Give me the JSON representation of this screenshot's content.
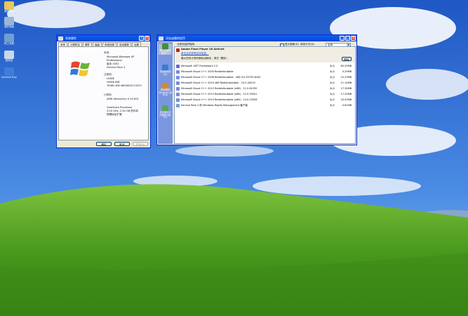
{
  "desktop": {
    "icons": [
      {
        "label": "我的文档",
        "icon": "folder-icon",
        "color": "#e8c85a"
      },
      {
        "label": "我的电脑",
        "icon": "computer-icon",
        "color": "#9ab6d6"
      },
      {
        "label": "网上邻居",
        "icon": "network-icon",
        "color": "#6f9fd0"
      },
      {
        "label": "回收站",
        "icon": "recycle-bin-icon",
        "color": "#c9d8e6"
      },
      {
        "label": "Internet Explorer",
        "icon": "ie-icon",
        "color": "#3d7dd8"
      }
    ]
  },
  "sysprops": {
    "title": "系统属性",
    "tabs": [
      "常规",
      "计算机名",
      "硬件",
      "高级",
      "系统还原",
      "自动更新",
      "远程"
    ],
    "system_header": "系统:",
    "os_lines": [
      "Microsoft Windows XP",
      "Professional",
      "版本 2002",
      "Service Pack 3"
    ],
    "registered_header": "注册到:",
    "registered_lines": [
      "HOME",
      "HOME-IDB",
      "76481-640-8834005-23370"
    ],
    "computer_header": "计算机:",
    "cpu_lines": [
      "AMD Athlon(tm) II X4 651",
      "",
      "QuadCore Processor",
      "3.00 GHz, 2.00 GB 的内存",
      "物理地址扩展"
    ],
    "ok": "确定",
    "cancel": "取消",
    "apply": "应用(A)"
  },
  "arp": {
    "title": "添加或删除程序",
    "sidebar": [
      {
        "label": "更改或删除程序(H)",
        "icon": "change-remove-icon",
        "color": "#3f8f3a"
      },
      {
        "label": "添加新程序(N)",
        "icon": "add-program-icon",
        "color": "#3a7ad6"
      },
      {
        "label": "添加/删除 Windows 组件(A)",
        "icon": "windows-components-icon",
        "color": "#d68a2e"
      },
      {
        "label": "设定程序访问和默认值(O)",
        "icon": "defaults-icon",
        "color": "#5aa35a"
      }
    ],
    "header": "当前安装的程序:",
    "show_updates": "显示更新(D)",
    "sort_label": "排序方式(S):",
    "sort_value": "名称",
    "selected": {
      "name": "Adobe Flash Player 26 ActiveX",
      "support_link": "单击此处获得支持信息。",
      "remove_text": "要从您的计算机删除该程序，单击 \"删除\"。",
      "remove_button": "删除"
    },
    "size_label": "大小",
    "programs": [
      {
        "name": "Microsoft .NET Framework 2.0",
        "size": "60.25MB",
        "color": "#6a6ad0"
      },
      {
        "name": "Microsoft Visual C++ 2005 Redistributable",
        "size": "0.29MB",
        "color": "#7a8ad6"
      },
      {
        "name": "Microsoft Visual C++ 2008 Redistributable - x86 9.0.30729.6161",
        "size": "10.23MB",
        "color": "#7a8ad6"
      },
      {
        "name": "Microsoft Visual C++ 2010  x86 Redistributable - 10.0.40219",
        "size": "11.14MB",
        "color": "#7a8ad6"
      },
      {
        "name": "Microsoft Visual C++ 2012 Redistributable (x86) - 11.0.61030",
        "size": "17.34MB",
        "color": "#7a8ad6"
      },
      {
        "name": "Microsoft Visual C++ 2013 Redistributable (x86) - 12.0.30501",
        "size": "17.20MB",
        "color": "#7a8ad6"
      },
      {
        "name": "Microsoft Visual C++ 2015 Redistributable (x86) - 14.0.23026",
        "size": "20.50MB",
        "color": "#7a8ad6"
      },
      {
        "name": "Service Pack 2 的 Windows Rights Management 客户端",
        "size": "0.61MB",
        "color": "#6aa0d8"
      }
    ]
  }
}
